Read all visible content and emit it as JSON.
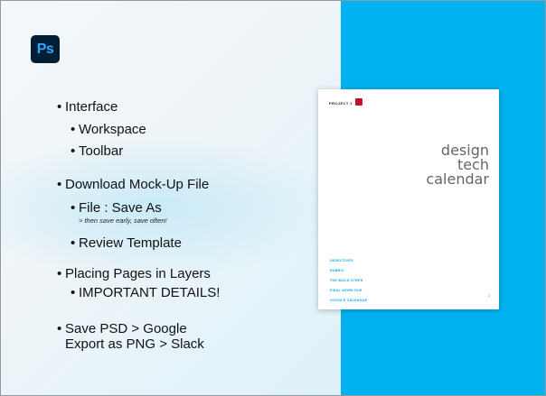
{
  "logo": {
    "text": "Ps"
  },
  "bullets": [
    {
      "text": "Interface"
    },
    {
      "text": "Workspace"
    },
    {
      "text": "Toolbar"
    },
    {
      "text": "Download Mock-Up File"
    },
    {
      "text": "File : Save As"
    },
    {
      "text": "Review Template"
    },
    {
      "text": "Placing Pages in Layers"
    },
    {
      "text": "IMPORTANT DETAILS!"
    },
    {
      "text": "Save PSD > Google"
    },
    {
      "text": "Export as PNG > Slack"
    }
  ],
  "note": "> then save early, save often!",
  "document": {
    "project_label": "PROJECT 1",
    "title_lines": [
      "design",
      "tech",
      "calendar"
    ],
    "links": [
      "OBJECTIVES",
      "RUBRIC",
      "THE BUILD STEPS",
      "FINAL WORK DUE",
      "GOOGLE CALENDAR"
    ],
    "page_number": "2"
  },
  "colors": {
    "accent_blue": "#00b2f0",
    "ps_logo_bg": "#001e36",
    "ps_logo_text": "#31a8ff",
    "project_badge": "#c8102e"
  }
}
